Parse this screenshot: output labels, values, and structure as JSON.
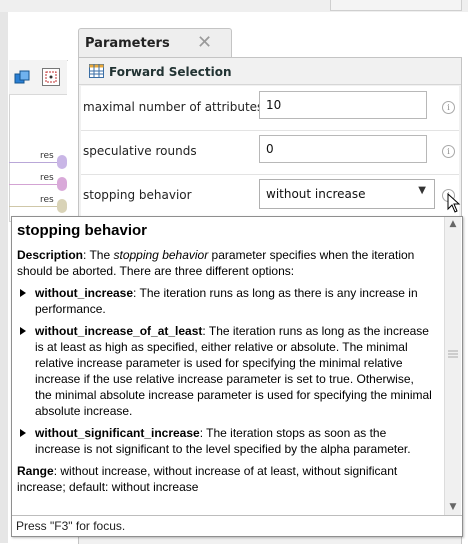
{
  "panel": {
    "title": "Parameters",
    "close_glyph": "✕",
    "operator_name": "Forward Selection",
    "operator_icon": "table-grid-icon"
  },
  "canvas": {
    "port_labels": [
      "res",
      "res",
      "res"
    ],
    "port_colors": [
      "#c9b6e6",
      "#d9a9d9",
      "#d9d3b7"
    ]
  },
  "params": [
    {
      "label": "maximal number of attributes",
      "value": "10",
      "type": "text"
    },
    {
      "label": "speculative rounds",
      "value": "0",
      "type": "text"
    },
    {
      "label": "stopping behavior",
      "value": "without increase",
      "type": "select"
    }
  ],
  "tooltip": {
    "title": "stopping behavior",
    "description_label": "Description",
    "description_pre": ": The ",
    "description_em": "stopping behavior",
    "description_post": " parameter specifies when the iteration should be aborted. There are three different options:",
    "options": [
      {
        "name": "without_increase",
        "text": ": The iteration runs as long as there is any increase in performance."
      },
      {
        "name": "without_increase_of_at_least",
        "text": ": The iteration runs as long as the increase is at least as high as specified, either relative or absolute. The minimal relative increase parameter is used for specifying the minimal relative increase if the use relative increase parameter is set to true. Otherwise, the minimal absolute increase parameter is used for specifying the minimal absolute increase."
      },
      {
        "name": "without_significant_increase",
        "text": ": The iteration stops as soon as the increase is not significant to the level specified by the alpha parameter."
      }
    ],
    "range_label": "Range",
    "range_text": ": without increase, without increase of at least, without significant increase; default: without increase",
    "footer": "Press \"F3\" for focus."
  },
  "colors": {
    "panel_bg": "#f1f1f1",
    "border": "#c4c4c4"
  }
}
